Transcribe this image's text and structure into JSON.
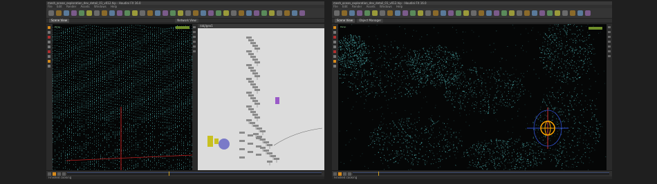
{
  "left_monitor": {
    "title": "mesh_ocean_exploration_dev_detail_01_v012.hip - Houdini FX 16.0",
    "menu": [
      "File",
      "Edit",
      "Render",
      "Assets",
      "Windows",
      "Help"
    ],
    "tabs": [
      {
        "label": "Scene View"
      },
      {
        "label": "Network View"
      }
    ],
    "viewport_label": "Persp",
    "status": "Finished cooking",
    "network_path": "/obj/geo1"
  },
  "right_monitor": {
    "title": "mesh_ocean_exploration_dev_detail_01_v012.hip - Houdini FX 16.0",
    "menu": [
      "File",
      "Edit",
      "Render",
      "Assets",
      "Windows",
      "Help"
    ],
    "tabs": [
      {
        "label": "Scene View"
      },
      {
        "label": "Object Manager"
      }
    ],
    "viewport_label": "Persp",
    "status": "Finished cooking"
  },
  "colors": {
    "mesh": "#58c8c8",
    "play_accent": "#d68a1c",
    "handle": "#ffa500"
  },
  "icons": {
    "play": "play-icon",
    "handle": "transform-handle-icon",
    "node": "node-icon"
  }
}
